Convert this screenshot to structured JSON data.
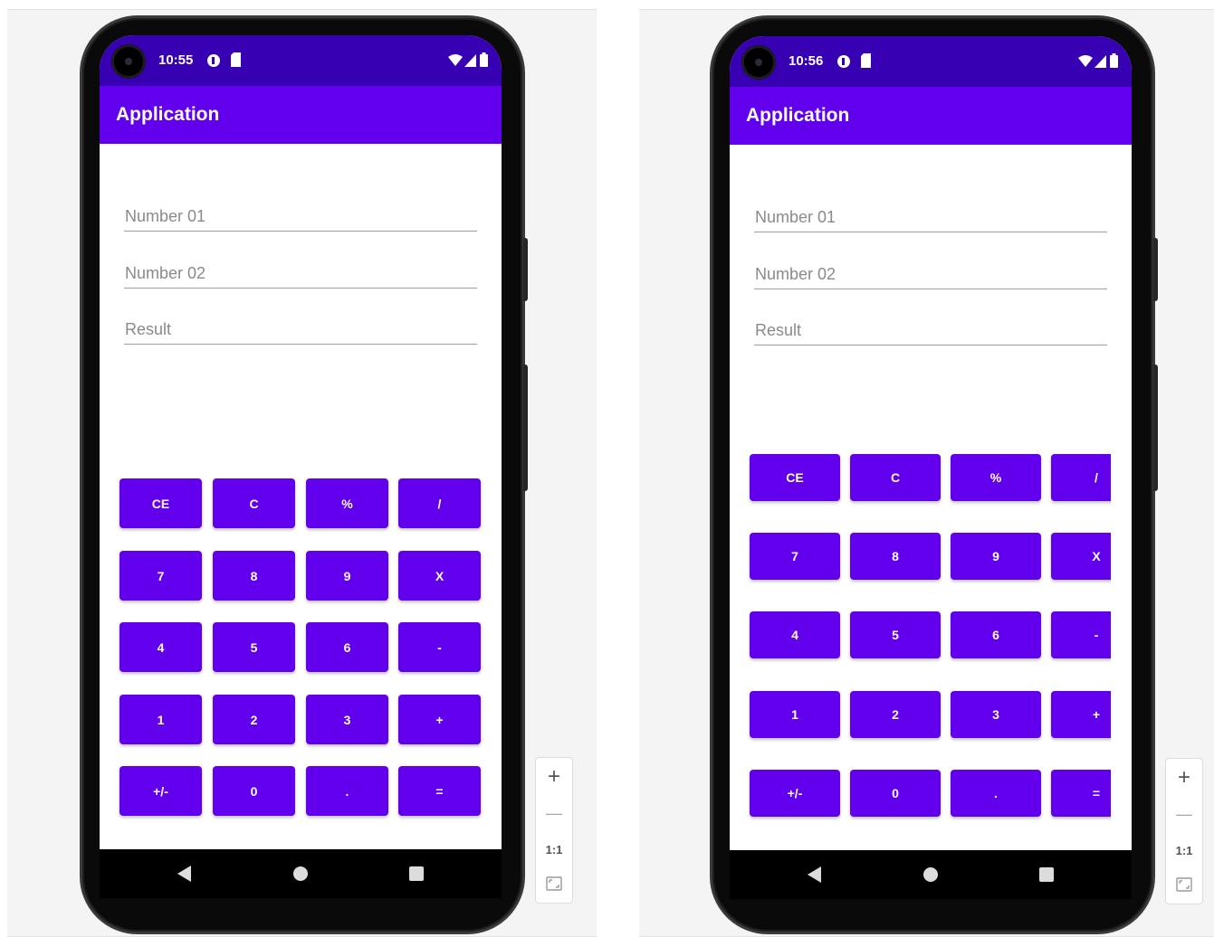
{
  "colors": {
    "status_bar": "#3700b3",
    "app_bar": "#6200ee",
    "key": "#6200ee",
    "panel": "#f4f4f4"
  },
  "left_device": {
    "status": {
      "time": "10:55",
      "icons": [
        "play-protect-icon",
        "sd-card-icon",
        "wifi-icon",
        "cell-signal-icon",
        "battery-icon"
      ]
    },
    "app_title": "Application",
    "fields": [
      {
        "placeholder": "Number 01",
        "value": ""
      },
      {
        "placeholder": "Number 02",
        "value": ""
      },
      {
        "placeholder": "Result",
        "value": ""
      }
    ],
    "keys": [
      [
        "CE",
        "C",
        "%",
        "/"
      ],
      [
        "7",
        "8",
        "9",
        "X"
      ],
      [
        "4",
        "5",
        "6",
        "-"
      ],
      [
        "1",
        "2",
        "3",
        "+"
      ],
      [
        "+/-",
        "0",
        ".",
        "="
      ]
    ],
    "nav": [
      "back-icon",
      "home-icon",
      "recents-icon"
    ]
  },
  "right_device": {
    "status": {
      "time": "10:56",
      "icons": [
        "play-protect-icon",
        "sd-card-icon",
        "wifi-icon",
        "cell-signal-icon",
        "battery-icon"
      ]
    },
    "app_title": "Application",
    "fields": [
      {
        "placeholder": "Number 01",
        "value": ""
      },
      {
        "placeholder": "Number 02",
        "value": ""
      },
      {
        "placeholder": "Result",
        "value": ""
      }
    ],
    "keys": [
      [
        "CE",
        "C",
        "%",
        "/"
      ],
      [
        "7",
        "8",
        "9",
        "X"
      ],
      [
        "4",
        "5",
        "6",
        "-"
      ],
      [
        "1",
        "2",
        "3",
        "+"
      ],
      [
        "+/-",
        "0",
        ".",
        "="
      ]
    ],
    "nav": [
      "back-icon",
      "home-icon",
      "recents-icon"
    ]
  },
  "zoom_controls": {
    "zoom_in": "+",
    "zoom_out": "—",
    "actual_size": "1:1",
    "fit_icon": "fit-screen-icon"
  }
}
